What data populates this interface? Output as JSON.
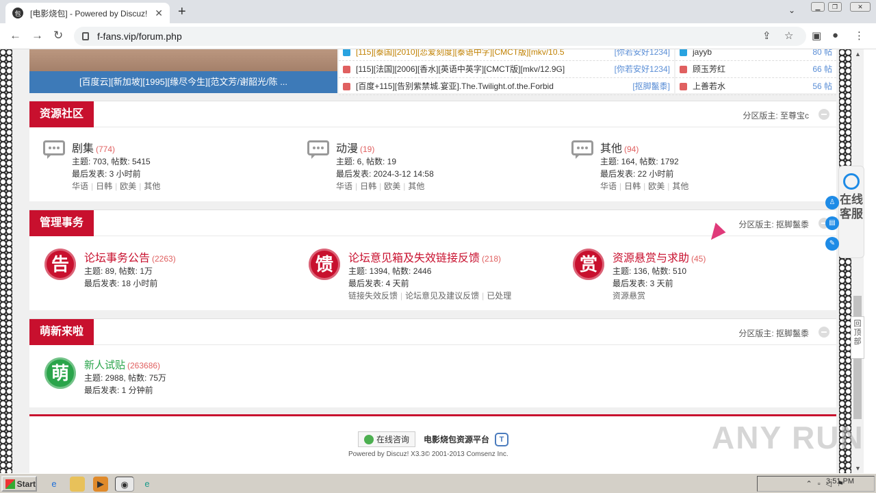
{
  "browser": {
    "tab_title": "[电影烧包] - Powered by Discuz!",
    "url": "f-fans.vip/forum.php"
  },
  "top": {
    "image_caption": "[百度云][新加坡][1995][缘尽今生][范文芳/谢韶光/陈 ...",
    "threads": [
      {
        "title": "[115][泰国][2010][恋爱刻度][泰语中字][CMCT版][mkv/10.5",
        "author": "[你若安好1234]",
        "icon_color": "#29a3e0"
      },
      {
        "title": "[115][法国][2006][香水][英语中英字][CMCT版][mkv/12.9G]",
        "author": "[你若安好1234]",
        "icon_color": "#e06060"
      },
      {
        "title": "[百度+115][告别紫禁城.宴亚].The.Twilight.of.the.Forbid",
        "author": "[抠脚鬣黍]",
        "icon_color": "#e06060"
      }
    ],
    "ranking": [
      {
        "name": "jayyb",
        "count": "80 帖",
        "icon_color": "#29a3e0"
      },
      {
        "name": "顾玉芳红",
        "count": "66 帖",
        "icon_color": "#e06060"
      },
      {
        "name": "上善若水",
        "count": "56 帖",
        "icon_color": "#e06060"
      }
    ]
  },
  "sections": [
    {
      "title": "资源社区",
      "moderator": "分区版主: 至尊宝c",
      "forums": [
        {
          "name": "剧集",
          "count": "(774)",
          "stats": "主题: 703, 帖数: 5415",
          "last": "最后发表: 3 小时前",
          "subs": [
            "华语",
            "日韩",
            "欧美",
            "其他"
          ]
        },
        {
          "name": "动漫",
          "count": "(19)",
          "stats": "主题: 6, 帖数: 19",
          "last": "最后发表: 2024-3-12 14:58",
          "subs": [
            "华语",
            "日韩",
            "欧美",
            "其他"
          ]
        },
        {
          "name": "其他",
          "count": "(94)",
          "stats": "主题: 164, 帖数: 1792",
          "last": "最后发表: 22 小时前",
          "subs": [
            "华语",
            "日韩",
            "欧美",
            "其他"
          ]
        }
      ]
    },
    {
      "title": "管理事务",
      "moderator": "分区版主: 抠脚鬣黍",
      "forums": [
        {
          "badge": "告",
          "badge_color": "#c8102e",
          "name": "论坛事务公告",
          "count": "(2263)",
          "stats": "主题: 89, 帖数: 1万",
          "last": "最后发表: 18 小时前",
          "subs": []
        },
        {
          "badge": "馈",
          "badge_color": "#c8102e",
          "name": "论坛意见箱及失效链接反馈",
          "count": "(218)",
          "stats": "主题: 1394, 帖数: 2446",
          "last": "最后发表: 4 天前",
          "subs": [
            "链接失效反馈",
            "论坛意见及建议反馈",
            "已处理"
          ]
        },
        {
          "badge": "赏",
          "badge_color": "#c8102e",
          "name": "资源悬赏与求助",
          "count": "(45)",
          "stats": "主题: 136, 帖数: 510",
          "last": "最后发表: 3 天前",
          "subs": [
            "资源悬赏"
          ]
        }
      ]
    },
    {
      "title": "萌新来啦",
      "moderator": "分区版主: 抠脚鬣黍",
      "forums": [
        {
          "badge": "萌",
          "badge_color": "#2aa44a",
          "name": "新人试贴",
          "count": "(263686)",
          "stats": "主题: 2988, 帖数: 75万",
          "last": "最后发表: 1 分钟前",
          "subs": []
        }
      ]
    }
  ],
  "footer": {
    "consult": "在线咨询",
    "platform": "电影烧包资源平台",
    "powered": "Powered by Discuz! X3.3© 2001-2013 Comsenz Inc."
  },
  "float": {
    "service": "在线客服",
    "totop": "回顶部"
  },
  "watermark": "ANY RUN",
  "taskbar": {
    "start": "Start",
    "clock": "3:51 PM"
  }
}
